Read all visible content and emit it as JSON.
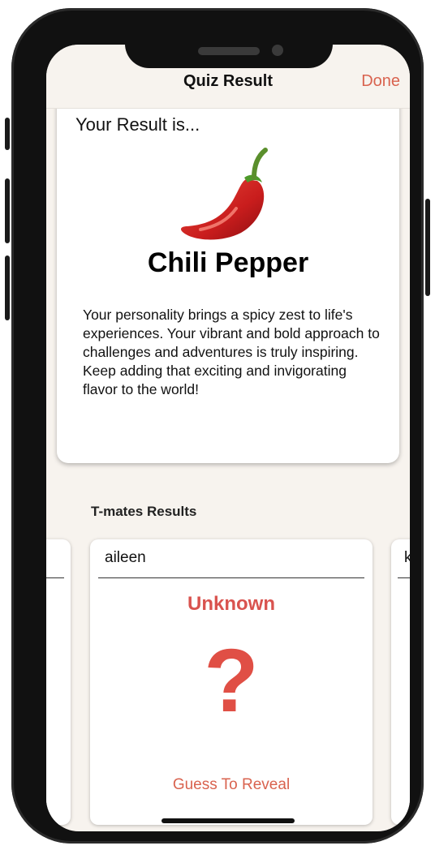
{
  "nav": {
    "title": "Quiz Result",
    "done_label": "Done"
  },
  "result": {
    "heading": "Your Result is...",
    "emoji_icon": "chili-pepper",
    "name": "Chili Pepper",
    "description": "Your personality brings a spicy zest to life's experiences. Your vibrant and bold approach to challenges and adventures is truly inspiring. Keep adding that exciting and invigorating flavor to the world!"
  },
  "tmates": {
    "section_title": "T-mates Results",
    "cards": [
      {
        "name": ""
      },
      {
        "name": "aileen",
        "result": "Unknown",
        "icon": "?",
        "guess_label": "Guess To Reveal"
      },
      {
        "name": "k"
      }
    ]
  },
  "colors": {
    "accent": "#d9634f",
    "unknown": "#d9534f",
    "background": "#f7f3ee"
  }
}
